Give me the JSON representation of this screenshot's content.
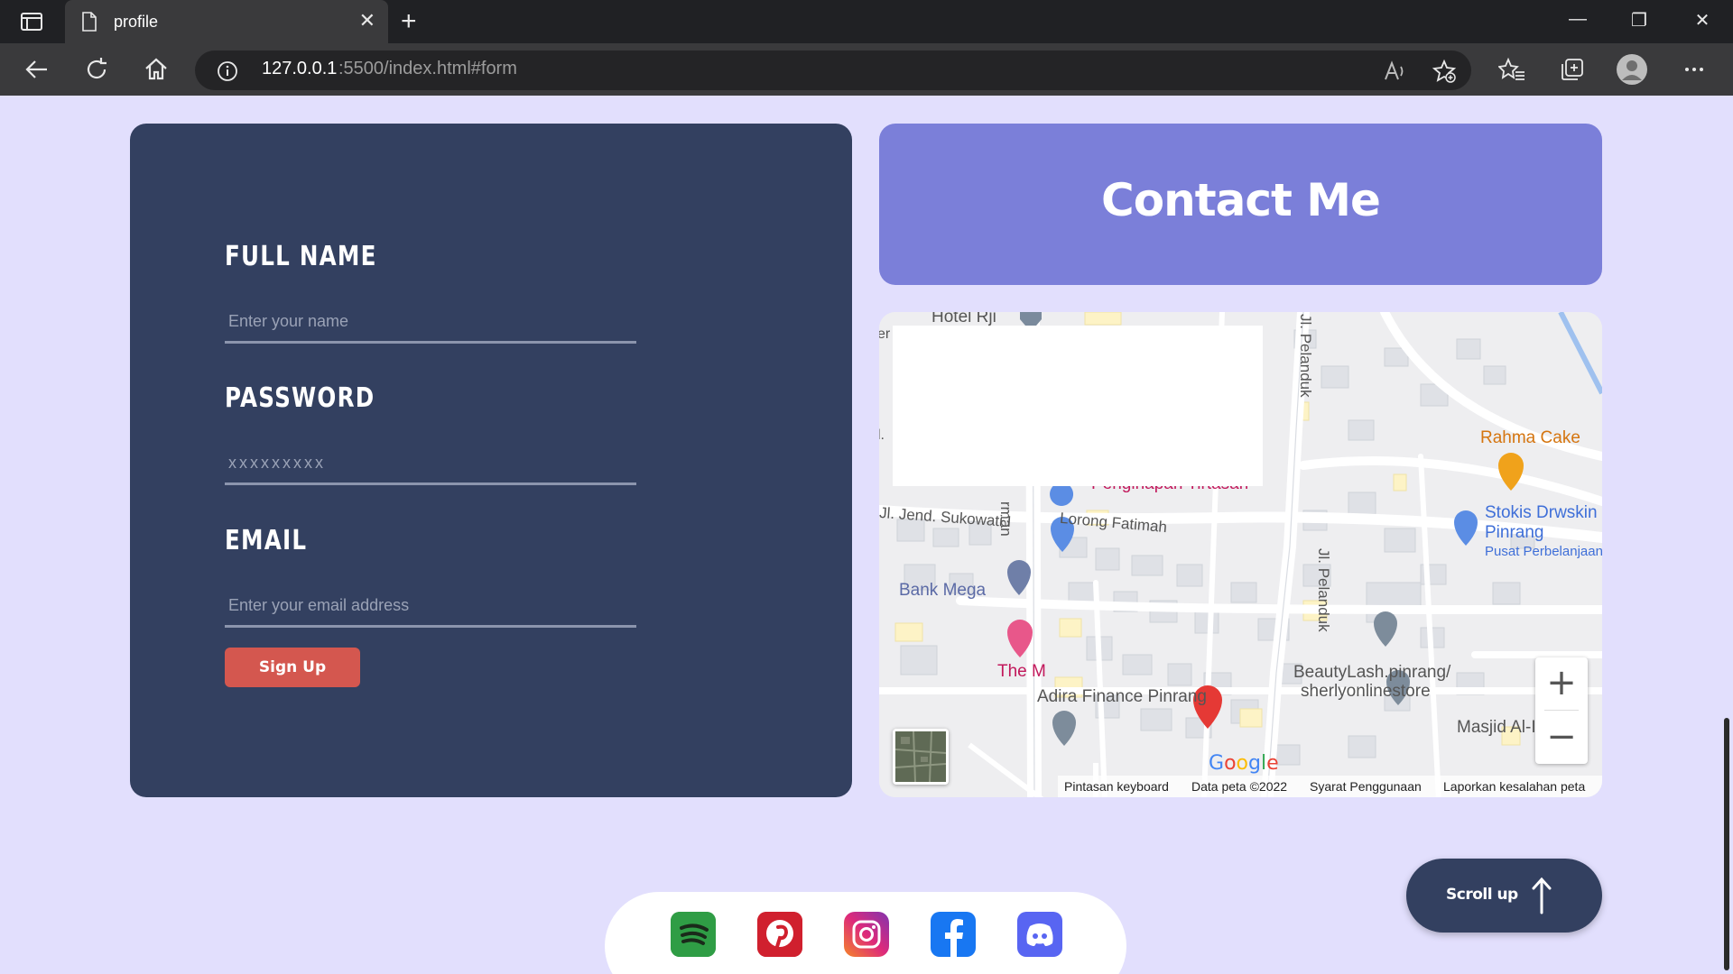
{
  "browser": {
    "tab_title": "profile",
    "url_host": "127.0.0.1",
    "url_path": ":5500/index.html#form"
  },
  "form": {
    "full_name_label": "FULL NAME",
    "full_name_placeholder": "Enter your name",
    "password_label": "PASSWORD",
    "password_placeholder": "xxxxxxxxx",
    "email_label": "EMAIL",
    "email_placeholder": "Enter your email address",
    "signup_label": "Sign Up"
  },
  "contact": {
    "title": "Contact Me"
  },
  "map": {
    "labels": {
      "hotel": "Hotel Rji",
      "road_partial_left": "er",
      "road_partial_l": "l.",
      "penginapan": "Penginapan Tirtasari",
      "sukowati": "Jl. Jend. Sukowati I",
      "rman": "rman",
      "lorong_fatimah": "Lorong Fatimah",
      "pelanduk_top": "Jl. Pelanduk",
      "pelanduk_mid": "Jl. Pelanduk",
      "rahma_cake": "Rahma Cake",
      "stokis_1": "Stokis Drwskin",
      "stokis_2": "Pinrang",
      "stokis_3": "Pusat Perbelanjaan",
      "bank_mega": "Bank Mega",
      "the_m": "The M",
      "adira": "Adira Finance Pinrang",
      "beautylash_1": "BeautyLash.pinrang/",
      "beautylash_2": "sherlyonlinestore",
      "masjid": "Masjid Al-Ikhwan"
    },
    "google_logo": "Google",
    "attribution": {
      "shortcuts": "Pintasan keyboard",
      "data": "Data peta ©2022",
      "terms": "Syarat Penggunaan",
      "report": "Laporkan kesalahan peta"
    },
    "zoom_in": "+",
    "zoom_out": "−"
  },
  "footer": {
    "social_icons": [
      "spotify-icon",
      "pinterest-icon",
      "instagram-icon",
      "facebook-icon",
      "discord-icon"
    ],
    "scroll_up_label": "Scroll up"
  },
  "colors": {
    "page_bg": "#e2dffd",
    "form_card": "#334060",
    "contact_card": "#7b7fd9",
    "signup_button": "#d4574f",
    "scroll_up_button": "#334060"
  }
}
